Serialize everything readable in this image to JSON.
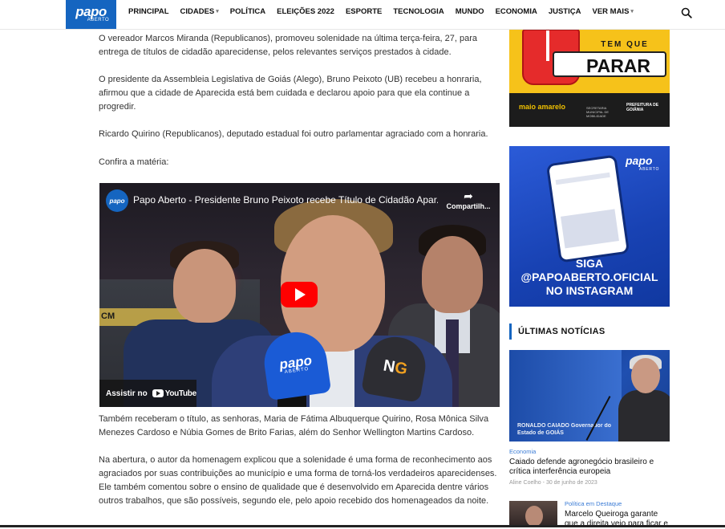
{
  "header": {
    "logo": {
      "line1": "papo",
      "line2": "ABERTO"
    },
    "nav": [
      {
        "label": "PRINCIPAL",
        "caret": false
      },
      {
        "label": "CIDADES",
        "caret": true
      },
      {
        "label": "POLÍTICA",
        "caret": false
      },
      {
        "label": "ELEIÇÕES 2022",
        "caret": false
      },
      {
        "label": "ESPORTE",
        "caret": false
      },
      {
        "label": "TECNOLOGIA",
        "caret": false
      },
      {
        "label": "MUNDO",
        "caret": false
      },
      {
        "label": "ECONOMIA",
        "caret": false
      },
      {
        "label": "JUSTIÇA",
        "caret": false
      },
      {
        "label": "VER MAIS",
        "caret": true
      }
    ],
    "search_icon": "search-icon"
  },
  "article": {
    "paragraphs": [
      "O vereador Marcos Miranda (Republicanos), promoveu solenidade na última terça-feira, 27, para entrega de títulos de cidadão aparecidense, pelos relevantes serviços prestados à cidade.",
      "O presidente da Assembleia Legislativa de Goiás (Alego), Bruno Peixoto (UB) recebeu a honraria, afirmou que a cidade de Aparecida está bem cuidada e declarou apoio para que ela continue a progredir.",
      "Ricardo Quirino (Republicanos), deputado estadual foi outro parlamentar agraciado com a honraria.",
      "Confira a matéria:",
      "Também receberam o título, as senhoras, Maria de Fátima Albuquerque Quirino, Rosa Mônica Silva Menezes Cardoso e Núbia Gomes de Brito Farias, além do Senhor Wellington Martins Cardoso.",
      "Na abertura, o autor da homenagem explicou que a solenidade é uma forma de reconhecimento aos agraciados por suas contribuições ao município e uma forma de torná-los verdadeiros aparecidenses. Ele também comentou sobre o ensino de qualidade que é desenvolvido em Aparecida dentre vários outros trabalhos, que são possíveis, segundo ele, pelo apoio recebido dos homenageados da noite."
    ]
  },
  "video": {
    "title": "Papo Aberto - Presidente Bruno Peixoto recebe Título de Cidadão Apar...",
    "share_label": "Compartilh...",
    "watch_on": "Assistir no",
    "youtube": "YouTube",
    "scene": {
      "bg_text": "CM",
      "mic1_line1": "papo",
      "mic1_line2": "ABERTO",
      "mic2_a": "N",
      "mic2_b": "G"
    }
  },
  "sidebar": {
    "ad1": {
      "tem_que": "TEM QUE",
      "parar": "PARAR",
      "maio": "maio amarelo",
      "secretaria": "SECRETARIA MUNICIPAL DE MOBILIDADE",
      "prefeitura": "PREFEITURA DE GOIÂNIA"
    },
    "ad2": {
      "logo1": "papo",
      "logo2": "ABERTO",
      "line1": "SIGA",
      "line2": "@PAPOABERTO.OFICIAL",
      "line3": "NO INSTAGRAM"
    },
    "section_title": "ÚLTIMAS NOTÍCIAS",
    "news": [
      {
        "image_caption": "RONALDO CAIADO Governador do Estado de GOIÁS",
        "category": "Economia",
        "title": "Caiado defende agronegócio brasileiro e crítica interferência europeia",
        "author": "Aline Coelho",
        "date": "30 de junho de 2023"
      },
      {
        "category": "Política em Destaque",
        "title": "Marcelo Queiroga garante que a direita veio para ficar e"
      }
    ]
  }
}
